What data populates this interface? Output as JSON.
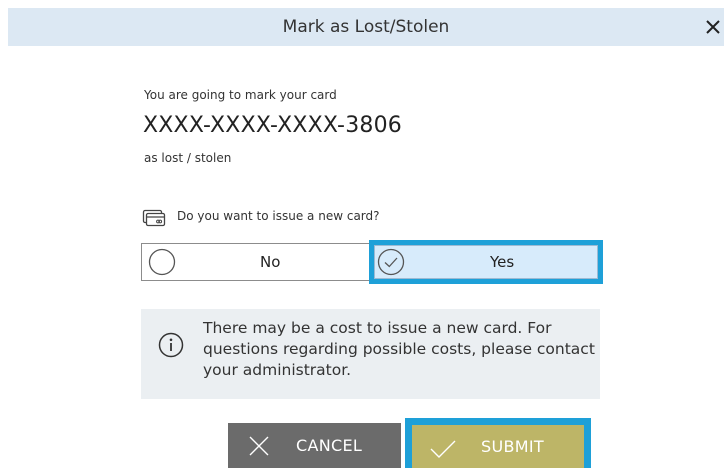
{
  "dialog": {
    "title": "Mark as Lost/Stolen",
    "close_icon": "close-icon"
  },
  "message": {
    "intro": "You are going to mark your card",
    "card_number": "XXXX-XXXX-XXXX-3806",
    "suffix": "as lost / stolen"
  },
  "new_card": {
    "question": "Do you want to issue a new card?",
    "icon": "card-icon",
    "options": [
      {
        "label": "No",
        "selected": false
      },
      {
        "label": "Yes",
        "selected": true
      }
    ]
  },
  "notice": {
    "icon": "info-icon",
    "text": "There may be a cost to issue a new card. For questions regarding possible costs, please contact your administrator."
  },
  "actions": {
    "cancel_label": "CANCEL",
    "submit_label": "SUBMIT"
  },
  "colors": {
    "titlebar": "#dce8f3",
    "focus_outline": "#1ea0d8",
    "selected_option": "#d7ebfb",
    "cancel_button": "#6b6b6b",
    "submit_button": "#bdb567",
    "notice_background": "#ebeff2"
  }
}
